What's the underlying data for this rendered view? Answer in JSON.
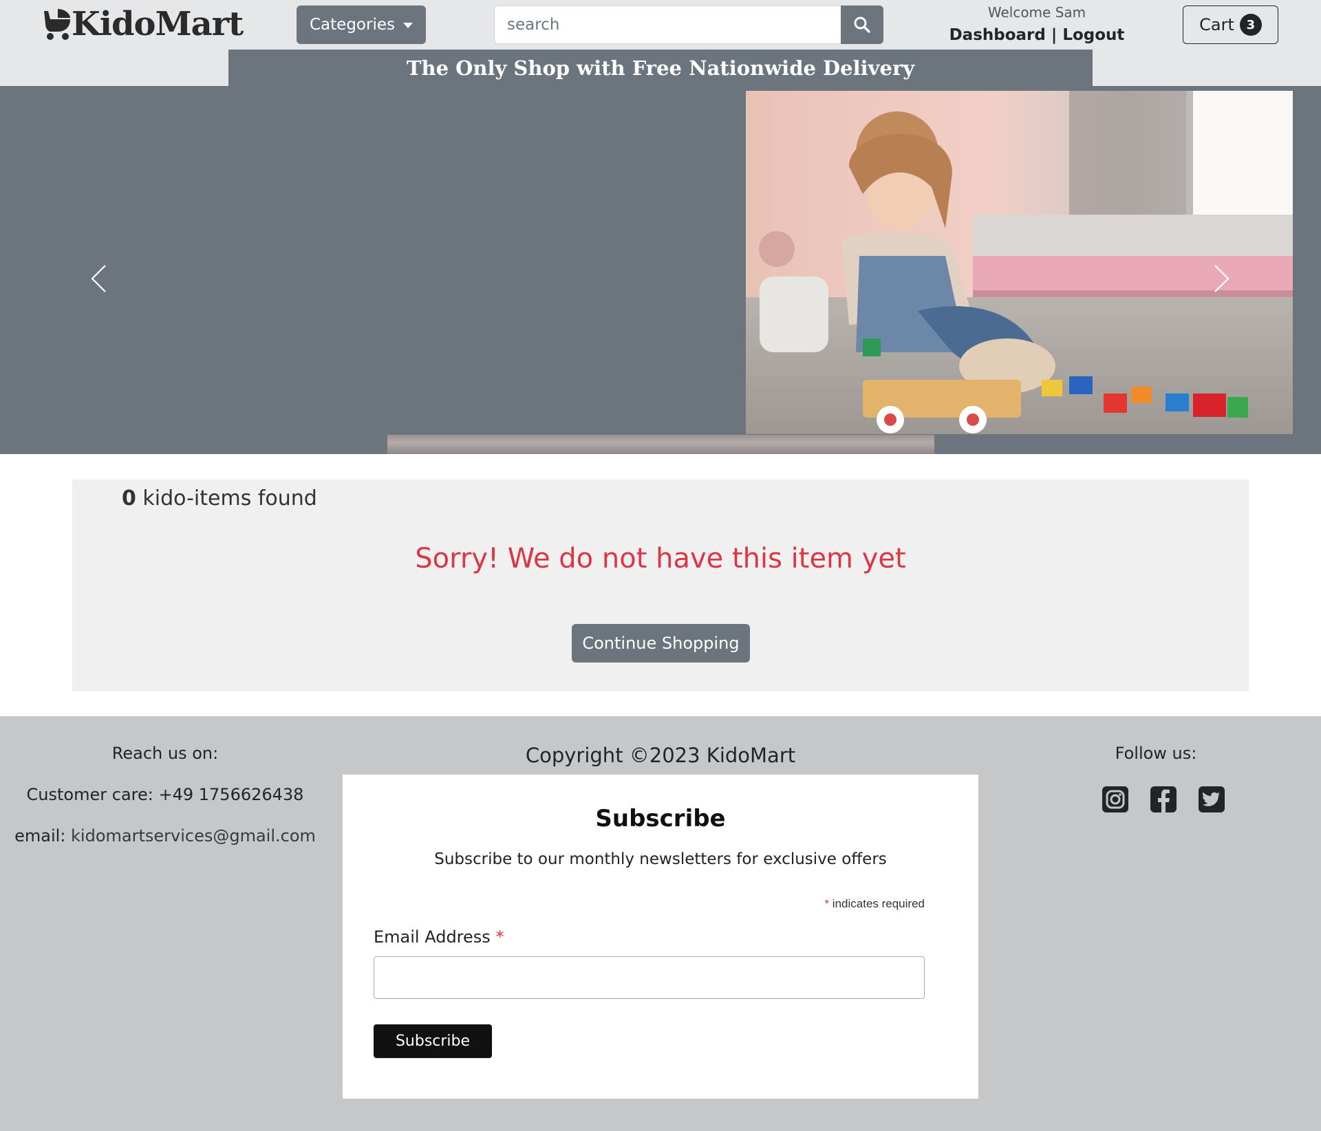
{
  "header": {
    "logo_text": "KidoMart",
    "logo_icon": "baby-stroller-icon",
    "categories_label": "Categories",
    "search": {
      "placeholder": "search",
      "value": ""
    },
    "welcome_text": "Welcome Sam",
    "dashboard_label": "Dashboard",
    "separator": "|",
    "logout_label": "Logout",
    "cart_label": "Cart",
    "cart_count": "3"
  },
  "banner": {
    "text": "The Only Shop with Free Nationwide Delivery"
  },
  "carousel": {
    "prev_icon": "chevron-left-icon",
    "next_icon": "chevron-right-icon",
    "slide_subject": "girl-playing-with-toy-blocks"
  },
  "results": {
    "count": "0",
    "count_suffix": "kido-items found",
    "empty_message": "Sorry! We do not have this item yet",
    "continue_label": "Continue Shopping"
  },
  "footer": {
    "reach_us": "Reach us on:",
    "customer_care": "Customer care: +49 1756626438",
    "email_prefix": "email:",
    "email_address": "kidomartservices@gmail.com",
    "copyright": "Copyright ©2023 KidoMart",
    "follow_us": "Follow us:",
    "social_icons": [
      "instagram-icon",
      "facebook-icon",
      "twitter-icon"
    ]
  },
  "subscribe": {
    "title": "Subscribe",
    "description": "Subscribe to our monthly newsletters for exclusive offers",
    "required_marker": "*",
    "required_note": "indicates required",
    "email_label": "Email Address",
    "email_value": "",
    "button_label": "Subscribe"
  },
  "colors": {
    "header_bg": "#e6e7e9",
    "accent_gray": "#6c757d",
    "danger": "#dc3545",
    "footer_bg": "#c6c7c8",
    "results_bg": "#f0f0f0"
  }
}
